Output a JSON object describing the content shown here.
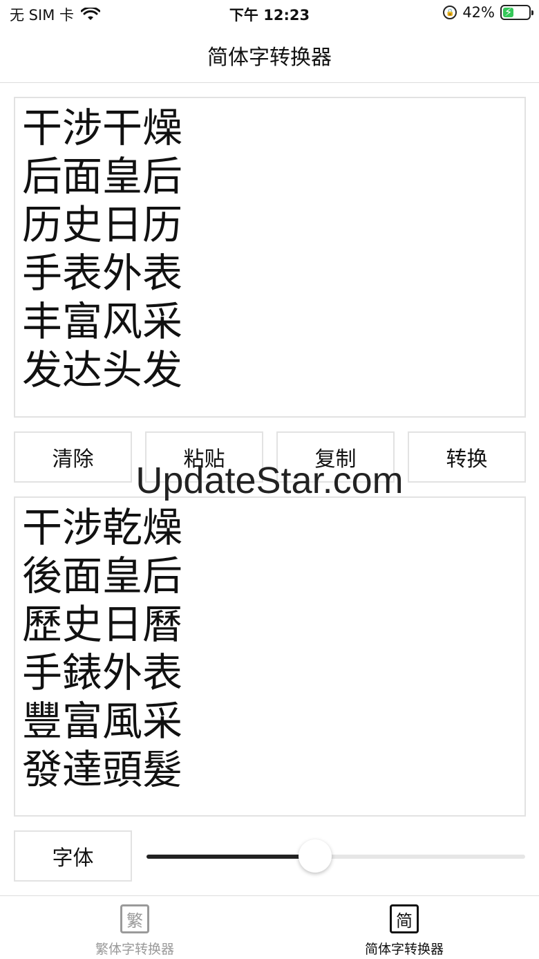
{
  "status_bar": {
    "carrier": "无 SIM 卡",
    "time": "下午 12:23",
    "battery_percent": "42%",
    "battery_level": 0.42,
    "battery_color": "#35c759"
  },
  "header": {
    "title": "简体字转换器"
  },
  "input_text": "干涉干燥\n后面皇后\n历史日历\n手表外表\n丰富风采\n发达头发",
  "buttons": {
    "clear": "清除",
    "paste": "粘贴",
    "copy": "复制",
    "convert": "转换"
  },
  "watermark": "UpdateStar.com",
  "output_text": "干涉乾燥\n後面皇后\n歷史日曆\n手錶外表\n豐富風采\n發達頭髮",
  "font_control": {
    "label": "字体",
    "slider_value": 0.445
  },
  "tabs": [
    {
      "label": "繁体字转换器",
      "icon_char": "繁",
      "active": false
    },
    {
      "label": "简体字转换器",
      "icon_char": "简",
      "active": true
    }
  ],
  "icons": {
    "wifi": "wifi-icon",
    "orientation_lock": "orientation-lock-icon",
    "battery": "battery-icon"
  }
}
